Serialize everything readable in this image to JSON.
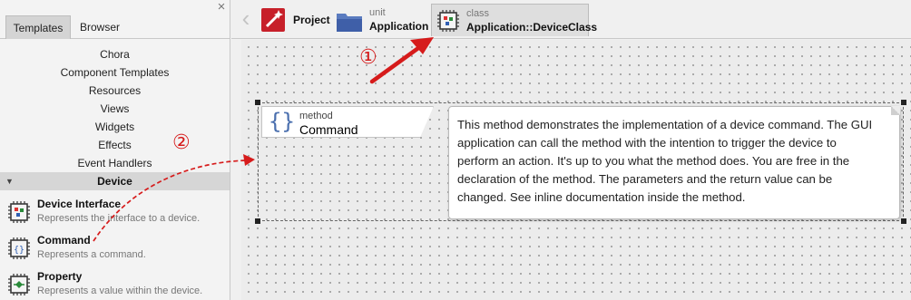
{
  "left_panel": {
    "tabs": [
      {
        "label": "Templates",
        "active": true
      },
      {
        "label": "Browser",
        "active": false
      }
    ],
    "close_glyph": "×",
    "categories": [
      "Chora",
      "Component Templates",
      "Resources",
      "Views",
      "Widgets",
      "Effects",
      "Event Handlers"
    ],
    "expanded_category": "Device",
    "templates": [
      {
        "name": "Device Interface",
        "description": "Represents the interface to a device.",
        "icon": "device-interface-icon"
      },
      {
        "name": "Command",
        "description": "Represents a command.",
        "icon": "command-icon"
      },
      {
        "name": "Property",
        "description": "Represents a value within the device.",
        "icon": "property-icon"
      }
    ]
  },
  "toolbar": {
    "back_glyph": "‹",
    "items": [
      {
        "small": "",
        "label": "Project",
        "icon": "project-icon"
      },
      {
        "small": "unit",
        "label": "Application",
        "icon": "unit-folder-icon"
      },
      {
        "small": "class",
        "label": "Application::DeviceClass",
        "icon": "class-icon",
        "active": true
      }
    ]
  },
  "canvas": {
    "method": {
      "kind": "method",
      "name": "Command",
      "icon": "curly-braces-icon"
    },
    "note": {
      "lines": [
        "This method demonstrates the implementation of a device command. The GUI",
        "application can call the method with the intention to trigger the device to",
        "perform an action. It's up to you what the method does. You are free in the",
        "declaration of the method. The parameters and the return value can be",
        "changed. See inline documentation inside the method."
      ]
    }
  },
  "annotations": {
    "step1": "①",
    "step2": "②",
    "color": "#d61b1b"
  },
  "colors": {
    "accent_red": "#d61b1b",
    "method_brace_blue": "#4a6fae",
    "chip_dark": "#3a3a3a",
    "selected_tab": "#d4d4d4"
  }
}
